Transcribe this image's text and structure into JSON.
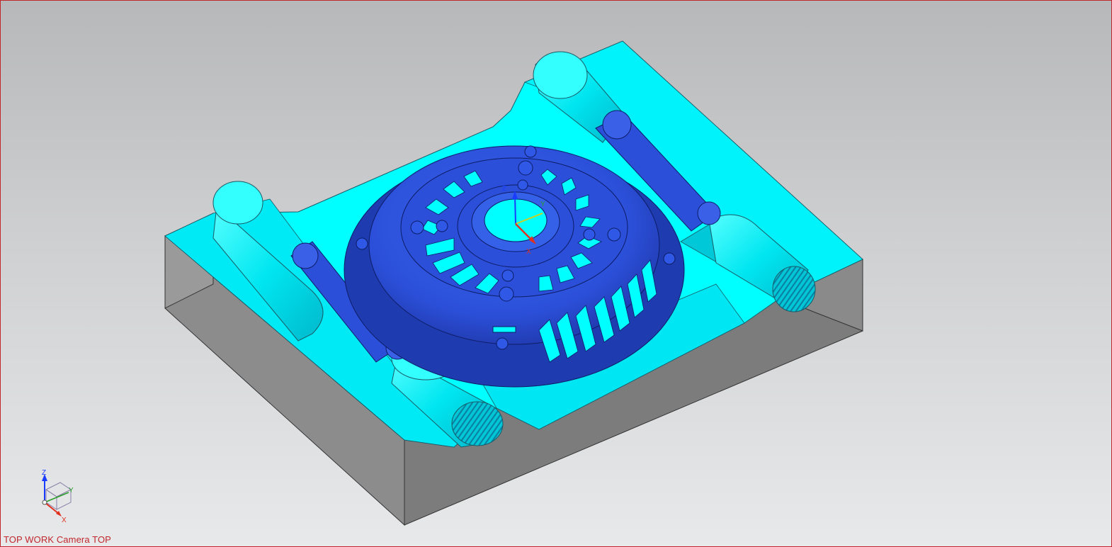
{
  "viewport": {
    "view_label": "TOP WORK Camera TOP",
    "border_color": "#c0272d"
  },
  "triad": {
    "z_label": "Z",
    "y_label": "Y",
    "x_label": "X"
  },
  "csys": {
    "z_label": "Z",
    "y_label": "Y",
    "x_label": "X"
  },
  "colors": {
    "stock_side_light": "#9c9c9c",
    "stock_side_dark": "#7a7a7a",
    "cavity_top": "#00ffff",
    "cavity_shade": "#00c8d8",
    "part_blue": "#2b4fd8",
    "part_dark": "#1f3bb0",
    "axis_z": "#1a3cff",
    "axis_y": "#2aa02a",
    "axis_x": "#e0301e"
  }
}
